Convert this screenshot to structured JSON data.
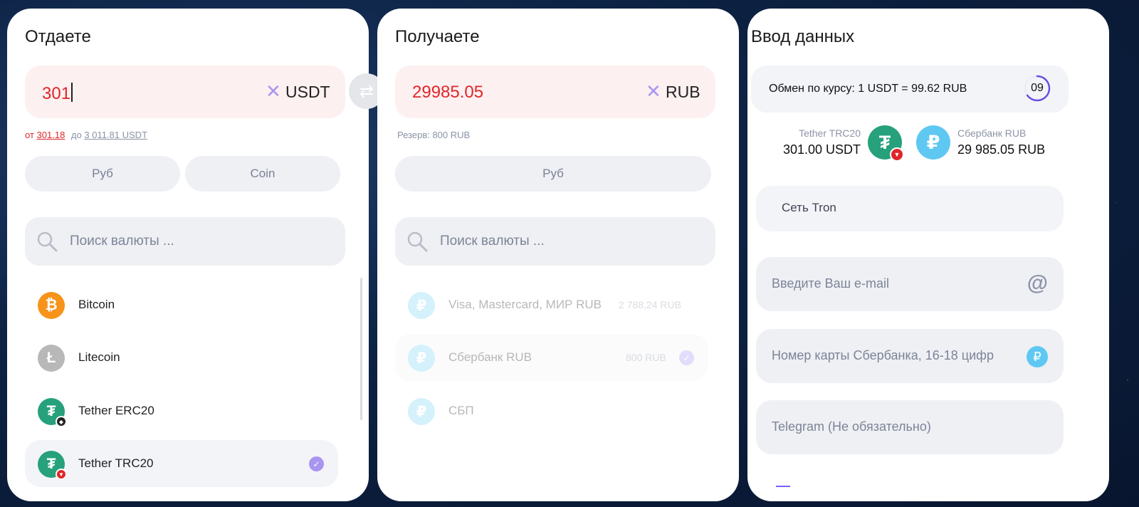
{
  "give": {
    "title": "Отдаете",
    "amount": "301",
    "clear": "✕",
    "currency": "USDT",
    "limits": {
      "from_label": "от",
      "from_value": "301.18",
      "to_label": "до",
      "to_value": "3 011.81 USDT"
    },
    "tabs": [
      "Руб",
      "Coin"
    ],
    "search_placeholder": "Поиск валюты ...",
    "coins": [
      {
        "name": "Bitcoin",
        "icon": "bitcoin-icon",
        "color": "#f7931a",
        "symbol": "₿"
      },
      {
        "name": "Litecoin",
        "icon": "litecoin-icon",
        "color": "#b8b8b8",
        "symbol": "Ł"
      },
      {
        "name": "Tether ERC20",
        "icon": "tether-icon",
        "color": "#26a17b",
        "symbol": "₮",
        "badge": "ethereum-badge-icon",
        "badge_color": "#222222"
      },
      {
        "name": "Tether TRC20",
        "icon": "tether-icon",
        "color": "#26a17b",
        "symbol": "₮",
        "badge": "tron-badge-icon",
        "badge_color": "#e0262b",
        "selected": true
      }
    ]
  },
  "receive": {
    "title": "Получаете",
    "amount": "29985.05",
    "clear": "✕",
    "currency": "RUB",
    "reserve": "Резерв: 800 RUB",
    "tabs": [
      "Руб"
    ],
    "search_placeholder": "Поиск валюты ...",
    "methods": [
      {
        "name": "Visa, Mastercard, МИР RUB",
        "amount": "2 788,24 RUB"
      },
      {
        "name": "Сбербанк RUB",
        "amount": "800 RUB",
        "selected": true
      },
      {
        "name": "СБП",
        "amount": ""
      }
    ]
  },
  "data_entry": {
    "title": "Ввод данных",
    "rate": "Обмен по курсу: 1 USDT = 99.62 RUB",
    "timer": "09",
    "timer_progress": 0.65,
    "from": {
      "label": "Tether TRC20",
      "amount": "301.00 USDT"
    },
    "to": {
      "label": "Сбербанк RUB",
      "amount": "29 985.05 RUB"
    },
    "network": "Сеть Tron",
    "email_placeholder": "Введите Ваш e-mail",
    "card_placeholder": "Номер карты Сбербанка, 16-18 цифр",
    "telegram_placeholder": "Telegram (Не обязательно)"
  },
  "colors": {
    "accent": "#a995f0",
    "error": "#e0262b",
    "tether": "#26a17b",
    "rub": "#7cd4f6"
  }
}
